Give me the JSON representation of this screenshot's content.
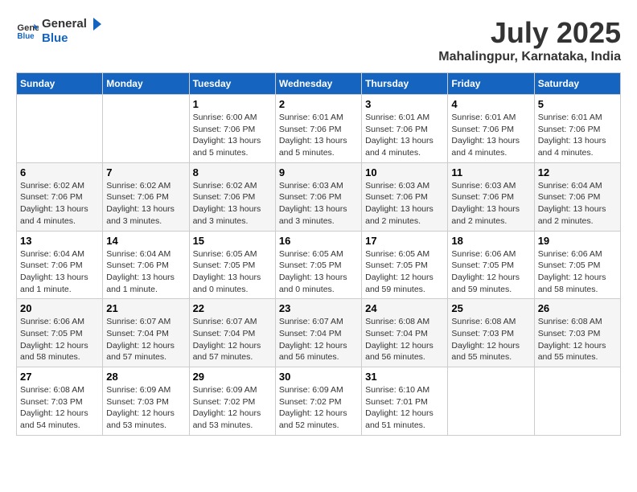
{
  "header": {
    "logo_general": "General",
    "logo_blue": "Blue",
    "month_year": "July 2025",
    "location": "Mahalingpur, Karnataka, India"
  },
  "days_of_week": [
    "Sunday",
    "Monday",
    "Tuesday",
    "Wednesday",
    "Thursday",
    "Friday",
    "Saturday"
  ],
  "weeks": [
    [
      {
        "day": "",
        "info": ""
      },
      {
        "day": "",
        "info": ""
      },
      {
        "day": "1",
        "info": "Sunrise: 6:00 AM\nSunset: 7:06 PM\nDaylight: 13 hours and 5 minutes."
      },
      {
        "day": "2",
        "info": "Sunrise: 6:01 AM\nSunset: 7:06 PM\nDaylight: 13 hours and 5 minutes."
      },
      {
        "day": "3",
        "info": "Sunrise: 6:01 AM\nSunset: 7:06 PM\nDaylight: 13 hours and 4 minutes."
      },
      {
        "day": "4",
        "info": "Sunrise: 6:01 AM\nSunset: 7:06 PM\nDaylight: 13 hours and 4 minutes."
      },
      {
        "day": "5",
        "info": "Sunrise: 6:01 AM\nSunset: 7:06 PM\nDaylight: 13 hours and 4 minutes."
      }
    ],
    [
      {
        "day": "6",
        "info": "Sunrise: 6:02 AM\nSunset: 7:06 PM\nDaylight: 13 hours and 4 minutes."
      },
      {
        "day": "7",
        "info": "Sunrise: 6:02 AM\nSunset: 7:06 PM\nDaylight: 13 hours and 3 minutes."
      },
      {
        "day": "8",
        "info": "Sunrise: 6:02 AM\nSunset: 7:06 PM\nDaylight: 13 hours and 3 minutes."
      },
      {
        "day": "9",
        "info": "Sunrise: 6:03 AM\nSunset: 7:06 PM\nDaylight: 13 hours and 3 minutes."
      },
      {
        "day": "10",
        "info": "Sunrise: 6:03 AM\nSunset: 7:06 PM\nDaylight: 13 hours and 2 minutes."
      },
      {
        "day": "11",
        "info": "Sunrise: 6:03 AM\nSunset: 7:06 PM\nDaylight: 13 hours and 2 minutes."
      },
      {
        "day": "12",
        "info": "Sunrise: 6:04 AM\nSunset: 7:06 PM\nDaylight: 13 hours and 2 minutes."
      }
    ],
    [
      {
        "day": "13",
        "info": "Sunrise: 6:04 AM\nSunset: 7:06 PM\nDaylight: 13 hours and 1 minute."
      },
      {
        "day": "14",
        "info": "Sunrise: 6:04 AM\nSunset: 7:06 PM\nDaylight: 13 hours and 1 minute."
      },
      {
        "day": "15",
        "info": "Sunrise: 6:05 AM\nSunset: 7:05 PM\nDaylight: 13 hours and 0 minutes."
      },
      {
        "day": "16",
        "info": "Sunrise: 6:05 AM\nSunset: 7:05 PM\nDaylight: 13 hours and 0 minutes."
      },
      {
        "day": "17",
        "info": "Sunrise: 6:05 AM\nSunset: 7:05 PM\nDaylight: 12 hours and 59 minutes."
      },
      {
        "day": "18",
        "info": "Sunrise: 6:06 AM\nSunset: 7:05 PM\nDaylight: 12 hours and 59 minutes."
      },
      {
        "day": "19",
        "info": "Sunrise: 6:06 AM\nSunset: 7:05 PM\nDaylight: 12 hours and 58 minutes."
      }
    ],
    [
      {
        "day": "20",
        "info": "Sunrise: 6:06 AM\nSunset: 7:05 PM\nDaylight: 12 hours and 58 minutes."
      },
      {
        "day": "21",
        "info": "Sunrise: 6:07 AM\nSunset: 7:04 PM\nDaylight: 12 hours and 57 minutes."
      },
      {
        "day": "22",
        "info": "Sunrise: 6:07 AM\nSunset: 7:04 PM\nDaylight: 12 hours and 57 minutes."
      },
      {
        "day": "23",
        "info": "Sunrise: 6:07 AM\nSunset: 7:04 PM\nDaylight: 12 hours and 56 minutes."
      },
      {
        "day": "24",
        "info": "Sunrise: 6:08 AM\nSunset: 7:04 PM\nDaylight: 12 hours and 56 minutes."
      },
      {
        "day": "25",
        "info": "Sunrise: 6:08 AM\nSunset: 7:03 PM\nDaylight: 12 hours and 55 minutes."
      },
      {
        "day": "26",
        "info": "Sunrise: 6:08 AM\nSunset: 7:03 PM\nDaylight: 12 hours and 55 minutes."
      }
    ],
    [
      {
        "day": "27",
        "info": "Sunrise: 6:08 AM\nSunset: 7:03 PM\nDaylight: 12 hours and 54 minutes."
      },
      {
        "day": "28",
        "info": "Sunrise: 6:09 AM\nSunset: 7:03 PM\nDaylight: 12 hours and 53 minutes."
      },
      {
        "day": "29",
        "info": "Sunrise: 6:09 AM\nSunset: 7:02 PM\nDaylight: 12 hours and 53 minutes."
      },
      {
        "day": "30",
        "info": "Sunrise: 6:09 AM\nSunset: 7:02 PM\nDaylight: 12 hours and 52 minutes."
      },
      {
        "day": "31",
        "info": "Sunrise: 6:10 AM\nSunset: 7:01 PM\nDaylight: 12 hours and 51 minutes."
      },
      {
        "day": "",
        "info": ""
      },
      {
        "day": "",
        "info": ""
      }
    ]
  ]
}
